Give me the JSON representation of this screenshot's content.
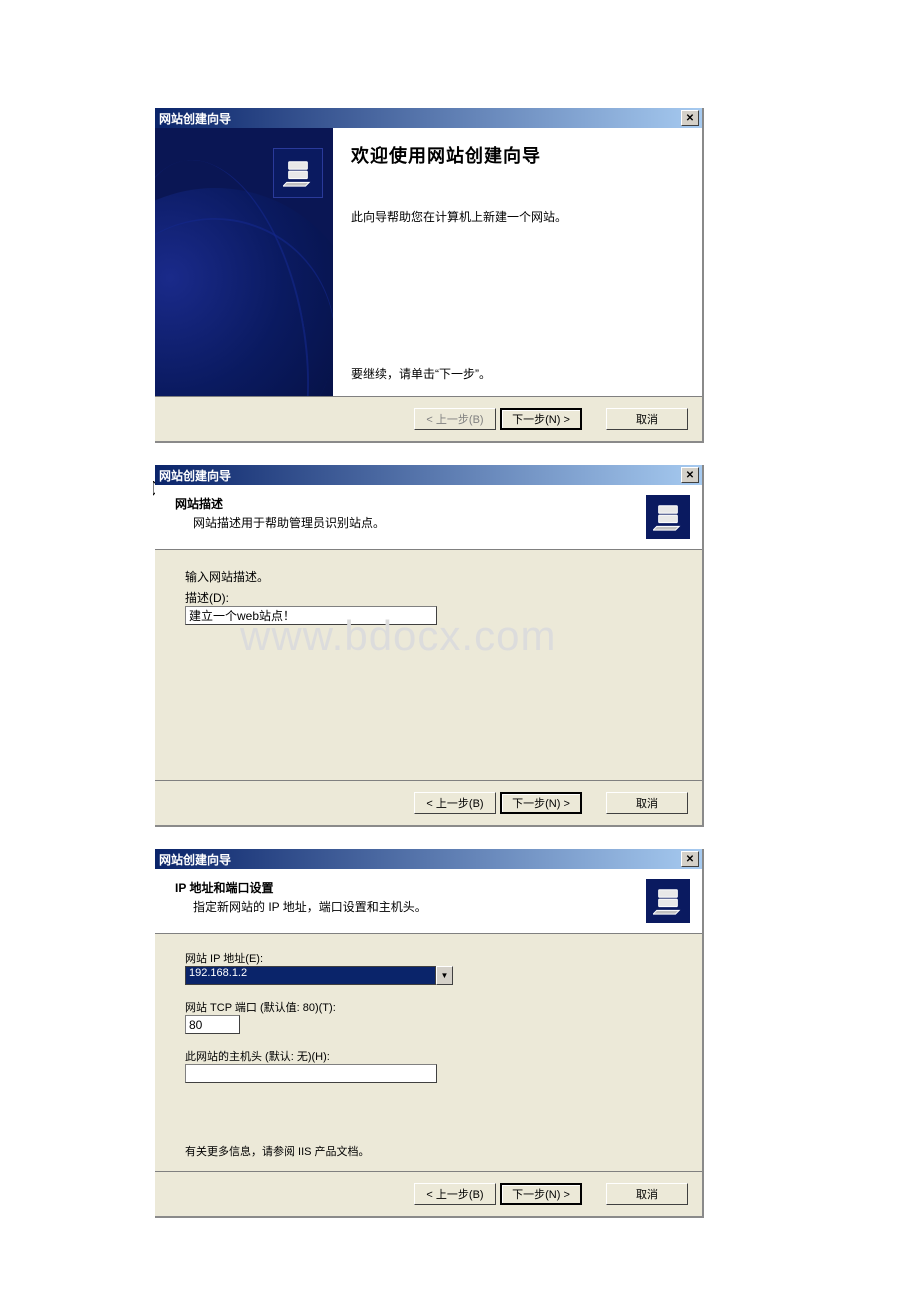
{
  "watermark": "www.bdocx.com",
  "dialog1": {
    "title": "网站创建向导",
    "welcome_title": "欢迎使用网站创建向导",
    "welcome_desc": "此向导帮助您在计算机上新建一个网站。",
    "continue_hint": "要继续，请单击“下一步”。",
    "back": "< 上一步(B)",
    "next": "下一步(N) >",
    "cancel": "取消"
  },
  "dialog2": {
    "title": "网站创建向导",
    "header_title": "网站描述",
    "header_sub": "网站描述用于帮助管理员识别站点。",
    "prompt": "输入网站描述。",
    "field_label": "描述(D):",
    "field_value": "建立一个web站点！",
    "back": "< 上一步(B)",
    "next": "下一步(N) >",
    "cancel": "取消"
  },
  "dialog3": {
    "title": "网站创建向导",
    "header_title": "IP 地址和端口设置",
    "header_sub": "指定新网站的 IP 地址，端口设置和主机头。",
    "ip_label": "网站 IP 地址(E):",
    "ip_value": "192.168.1.2",
    "port_label": "网站 TCP 端口 (默认值: 80)(T):",
    "port_value": "80",
    "host_label": "此网站的主机头 (默认: 无)(H):",
    "host_value": "",
    "info": "有关更多信息，请参阅 IIS 产品文档。",
    "back": "< 上一步(B)",
    "next": "下一步(N) >",
    "cancel": "取消"
  }
}
